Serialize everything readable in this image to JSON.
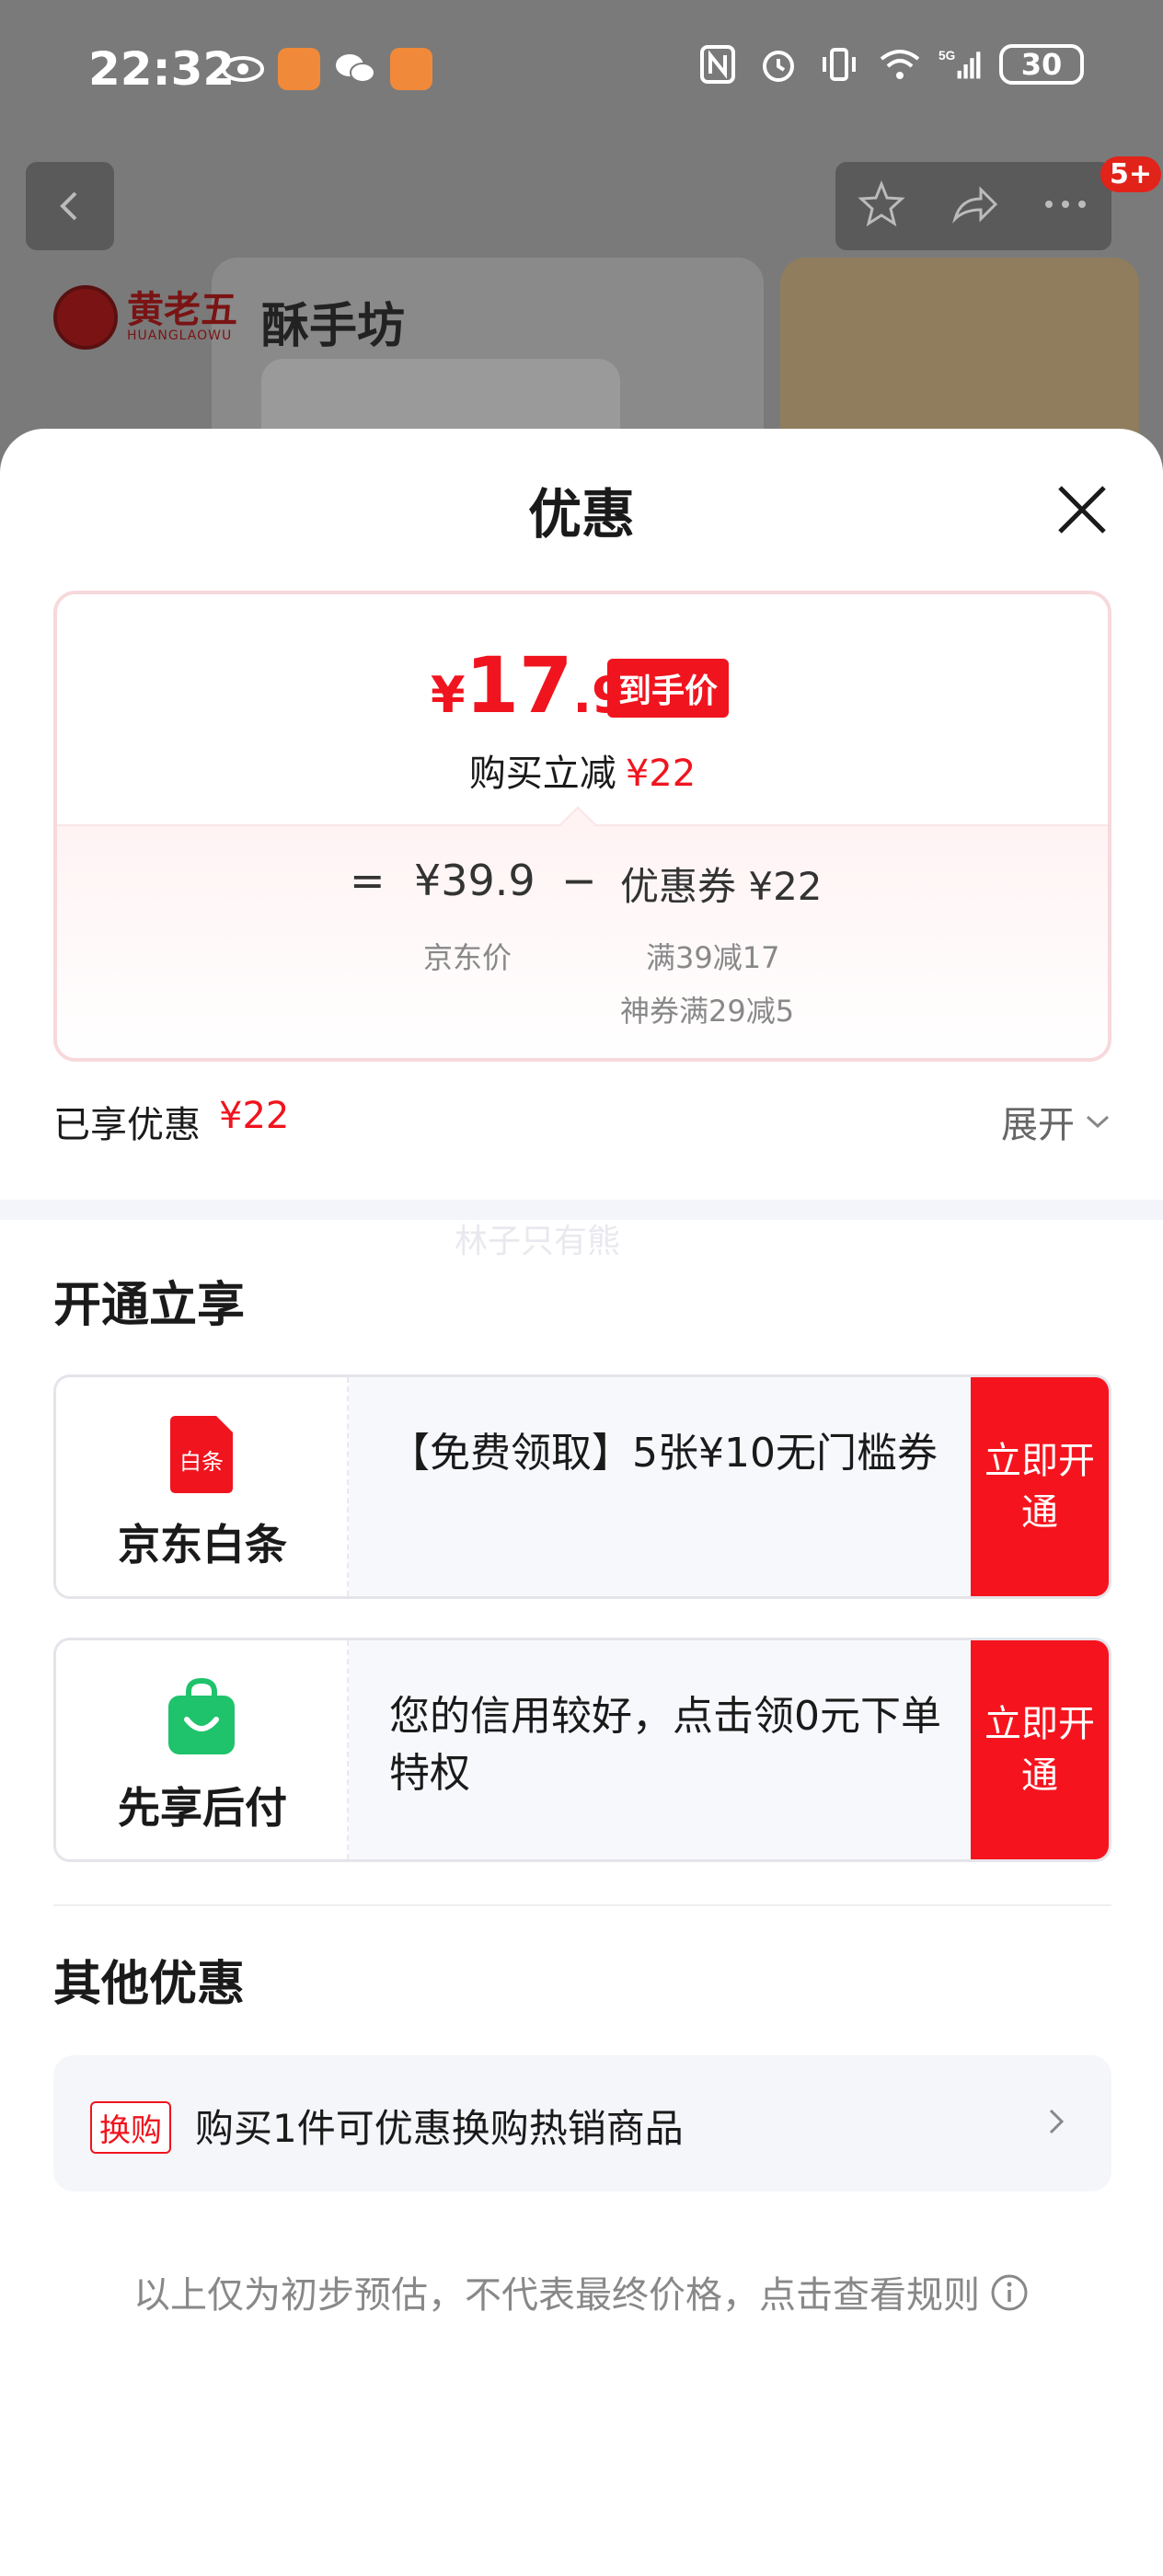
{
  "status_bar": {
    "time": "22:32",
    "battery": "30",
    "signal_label": "5G"
  },
  "background": {
    "brand_name": "黄老五",
    "brand_pinyin": "HUANGLAOWU",
    "brand_logo2": "酥手坊",
    "badge": "5+"
  },
  "sheet": {
    "title": "优惠"
  },
  "price_card": {
    "currency": "¥",
    "final_int": "17",
    "final_dec": ".9",
    "tag": "到手价",
    "instant_cut_label": "购买立减",
    "instant_cut_value": "¥22",
    "equals": "=",
    "jd_price": "¥39.9",
    "minus": "−",
    "coupon_label": "优惠券 ¥22",
    "jd_price_label": "京东价",
    "coupon_detail_1": "满39减17",
    "coupon_detail_2": "神券满29减5"
  },
  "enjoyed": {
    "label": "已享优惠",
    "value": "¥22",
    "expand_label": "展开"
  },
  "watermark": "林子只有熊",
  "open_section": {
    "title": "开通立享",
    "items": [
      {
        "name": "京东白条",
        "icon_label": "白条",
        "desc": "【免费领取】5张¥10无门槛券",
        "button": "立即开通"
      },
      {
        "name": "先享后付",
        "desc": "您的信用较好，点击领0元下单特权",
        "button": "立即开通"
      }
    ]
  },
  "other_section": {
    "title": "其他优惠",
    "swap_tag": "换购",
    "swap_text": "购买1件可优惠换购热销商品"
  },
  "disclaimer": "以上仅为初步预估，不代表最终价格，点击查看规则",
  "colors": {
    "accent_red": "#f0141e",
    "button_red": "#f5141e",
    "green": "#1fc36b"
  }
}
